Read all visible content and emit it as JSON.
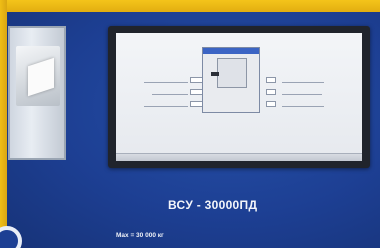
{
  "model_label": "ВСУ - 30000ПД",
  "spec_label": "Max =  30 000 кг",
  "screen": {
    "dialog_title": "",
    "dialog_date": "",
    "left_labels": [
      "",
      "",
      ""
    ],
    "right_labels": [
      "",
      "",
      ""
    ]
  },
  "colors": {
    "panel_blue": "#1d3f93",
    "casing_yellow": "#f0be16",
    "text_white": "#f3f5fa"
  }
}
